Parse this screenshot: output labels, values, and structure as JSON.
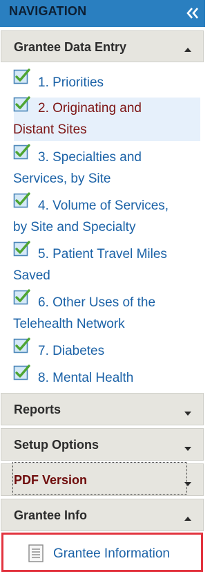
{
  "header": {
    "title": "NAVIGATION",
    "collapse_icon": "double-chevron-left-icon"
  },
  "sections": {
    "grantee_data_entry": {
      "label": "Grantee Data Entry",
      "expanded": true,
      "items": [
        {
          "number": "1.",
          "label": "1. Priorities",
          "line1": "1. Priorities",
          "line2": "",
          "active": false
        },
        {
          "label": "2. Originating and Distant Sites",
          "line1": "2. Originating and",
          "line2": "Distant Sites",
          "active": true
        },
        {
          "label": "3. Specialties and Services, by Site",
          "line1": "3. Specialties and",
          "line2": "Services, by Site",
          "active": false
        },
        {
          "label": "4. Volume of Services, by Site and Specialty",
          "line1": "4. Volume of Services,",
          "line2": "by Site and Specialty",
          "active": false
        },
        {
          "label": "5. Patient Travel Miles Saved",
          "line1": "5. Patient Travel Miles",
          "line2": "Saved",
          "active": false
        },
        {
          "label": "6. Other Uses of the Telehealth Network",
          "line1": "6. Other Uses of the",
          "line2": "Telehealth Network",
          "active": false
        },
        {
          "label": "7. Diabetes",
          "line1": "7. Diabetes",
          "line2": "",
          "active": false
        },
        {
          "label": "8. Mental Health",
          "line1": "8. Mental Health",
          "line2": "",
          "active": false
        }
      ]
    },
    "reports": {
      "label": "Reports",
      "expanded": false
    },
    "setup_options": {
      "label": "Setup Options",
      "expanded": false
    },
    "pdf_version": {
      "label": "PDF Version",
      "expanded": false
    },
    "grantee_info": {
      "label": "Grantee Info",
      "expanded": true,
      "items": [
        {
          "label": "Grantee Information",
          "icon": "document-icon"
        }
      ]
    }
  },
  "colors": {
    "header_bg": "#2a7fc0",
    "section_bg": "#e6e5df",
    "link": "#1b62a7",
    "active_link": "#7d1515",
    "active_bg": "#e6f0fb",
    "highlight_border": "#e2333e"
  }
}
